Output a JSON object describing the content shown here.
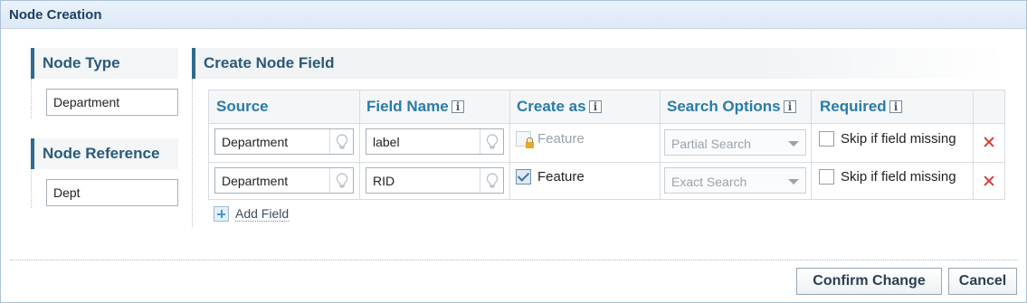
{
  "dialog": {
    "title": "Node Creation"
  },
  "left_panel": {
    "node_type": {
      "heading": "Node Type",
      "value": "Department"
    },
    "node_reference": {
      "heading": "Node Reference",
      "value": "Dept"
    }
  },
  "main": {
    "heading": "Create Node Field",
    "columns": [
      {
        "label": "Source",
        "has_info": false
      },
      {
        "label": "Field Name",
        "has_info": true
      },
      {
        "label": "Create as",
        "has_info": true
      },
      {
        "label": "Search Options",
        "has_info": true
      },
      {
        "label": "Required",
        "has_info": true
      }
    ],
    "rows": [
      {
        "source": "Department",
        "field_name": "label",
        "create_as": {
          "label": "Feature",
          "checked": false,
          "locked": true
        },
        "search_option": "Partial Search",
        "required": {
          "label": "Skip if field missing",
          "checked": false
        }
      },
      {
        "source": "Department",
        "field_name": "RID",
        "create_as": {
          "label": "Feature",
          "checked": true,
          "locked": false
        },
        "search_option": "Exact Search",
        "required": {
          "label": "Skip if field missing",
          "checked": false
        }
      }
    ],
    "add_field_label": "Add Field"
  },
  "buttons": {
    "confirm": "Confirm Change",
    "cancel": "Cancel"
  },
  "colors": {
    "accent": "#2a7ca6",
    "section_bar": "#2d6b8f",
    "delete": "#d93a3a"
  },
  "icons": {
    "info": "info-icon",
    "bulb": "lightbulb-icon",
    "lock": "lock-icon",
    "delete": "delete-x-icon",
    "add": "plus-icon",
    "dropdown": "chevron-down-icon"
  }
}
